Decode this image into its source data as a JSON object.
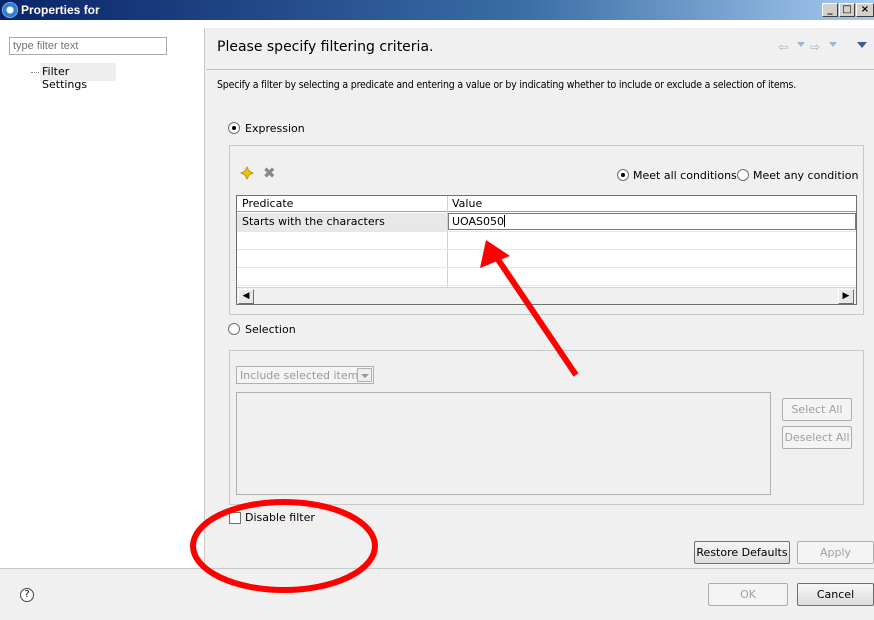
{
  "window": {
    "title": "Properties for"
  },
  "left": {
    "filter_placeholder": "type filter text",
    "tree_item": "Filter Settings"
  },
  "header": {
    "title": "Please specify filtering criteria."
  },
  "description": "Specify a filter by selecting a predicate and entering a value or by indicating whether to include or exclude a selection of items.",
  "expression": {
    "label": "Expression",
    "selected": true,
    "meet_all_label": "Meet all conditions",
    "meet_any_label": "Meet any condition",
    "table": {
      "columns": [
        "Predicate",
        "Value"
      ],
      "rows": [
        {
          "predicate": "Starts with the characters",
          "value": "UOAS050"
        }
      ]
    }
  },
  "selection": {
    "label": "Selection",
    "dropdown_value": "Include selected items",
    "select_all_label": "Select All",
    "deselect_all_label": "Deselect All"
  },
  "disable_filter_label": "Disable filter",
  "buttons": {
    "restore_defaults": "Restore Defaults",
    "apply": "Apply",
    "ok": "OK",
    "cancel": "Cancel"
  },
  "help_icon_text": "?",
  "colors": {
    "annotation": "#ff0000"
  }
}
